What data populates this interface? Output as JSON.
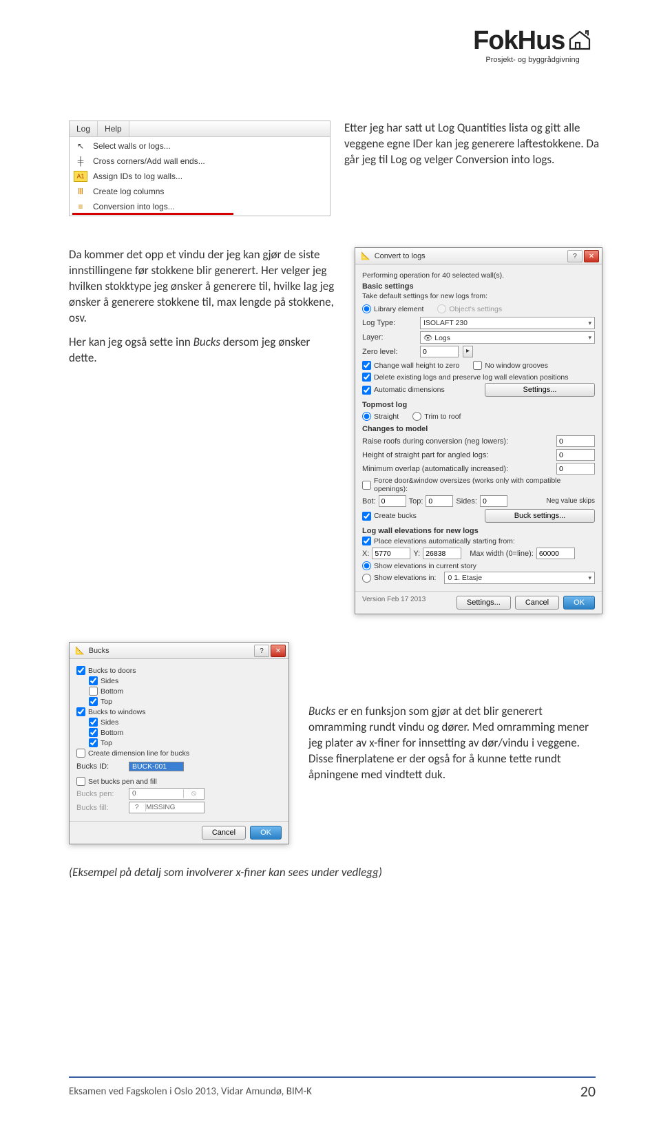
{
  "logo": {
    "main": "FokHus",
    "sub": "Prosjekt- og byggrådgivning",
    "house_icon": "house-outline-icon"
  },
  "menu": {
    "tabs": [
      "Log",
      "Help"
    ],
    "items": [
      {
        "icon": "cursor-icon",
        "label": "Select walls or logs..."
      },
      {
        "icon": "cross-icon",
        "label": "Cross corners/Add wall ends..."
      },
      {
        "icon": "a1-icon",
        "label": "Assign IDs to log walls..."
      },
      {
        "icon": "columns-icon",
        "label": "Create log columns"
      },
      {
        "icon": "logs-icon",
        "label": "Conversion into logs..."
      }
    ]
  },
  "para1": "Etter jeg har satt ut Log Quantities lista og gitt alle veggene egne IDer kan jeg generere laftestokkene. Da går jeg til Log og velger Conversion into logs.",
  "para2a": "Da kommer det opp et vindu der jeg kan gjør de siste innstillingene før stokkene blir generert. Her velger jeg hvilken stokktype jeg ønsker å generere til, hvilke lag jeg ønsker å generere stokkene til, max lengde på stokkene, osv.",
  "para2b": "Her kan jeg også sette inn Bucks dersom jeg ønsker dette.",
  "convert": {
    "title": "Convert to logs",
    "operation": "Performing operation for 40 selected wall(s).",
    "basic": "Basic settings",
    "take_from": "Take default settings for new logs from:",
    "radio_lib": "Library element",
    "radio_obj": "Object's settings",
    "log_type_label": "Log Type:",
    "log_type": "ISOLAFT 230",
    "layer_label": "Layer:",
    "layer": "Logs",
    "zero_label": "Zero level:",
    "zero": "0",
    "cb_change": "Change wall height to zero",
    "cb_nogroove": "No window grooves",
    "cb_delete": "Delete existing logs and preserve log wall elevation positions",
    "cb_auto": "Automatic dimensions",
    "settings_btn": "Settings...",
    "topmost": "Topmost log",
    "radio_straight": "Straight",
    "radio_trim": "Trim to roof",
    "changes": "Changes to model",
    "raise": "Raise roofs during conversion (neg lowers):",
    "height_straight": "Height of straight part for angled logs:",
    "min_overlap": "Minimum overlap (automatically increased):",
    "val0": "0",
    "cb_force": "Force door&window oversizes (works only with compatible openings):",
    "bot_label": "Bot:",
    "top_label": "Top:",
    "sides_label": "Sides:",
    "neg_label": "Neg value skips",
    "cb_bucks": "Create bucks",
    "buck_settings": "Buck settings...",
    "elev_title": "Log wall elevations for new logs",
    "cb_place": "Place elevations automatically starting from:",
    "x_label": "X:",
    "x": "5770",
    "y_label": "Y:",
    "y": "26838",
    "maxw_label": "Max width (0=line):",
    "maxw": "60000",
    "radio_current": "Show elevations in current story",
    "radio_showin": "Show elevations in:",
    "story": "0 1. Etasje",
    "version": "Version Feb 17 2013",
    "settings": "Settings...",
    "cancel": "Cancel",
    "ok": "OK"
  },
  "bucks": {
    "title": "Bucks",
    "cb_doors": "Bucks to doors",
    "cb_sides": "Sides",
    "cb_bottom": "Bottom",
    "cb_top": "Top",
    "cb_windows": "Bucks to windows",
    "cb_dim": "Create dimension line for bucks",
    "id_label": "Bucks ID:",
    "id": "BUCK-001",
    "cb_pen": "Set bucks pen and fill",
    "pen_label": "Bucks pen:",
    "pen": "0",
    "fill_label": "Bucks fill:",
    "fill_idx": "?",
    "fill": "MISSING",
    "cancel": "Cancel",
    "ok": "OK"
  },
  "para3": "Bucks er en funksjon som gjør at det blir generert omramming rundt vindu og dører. Med omramming mener jeg plater av x-finer for innsetting av dør/vindu i veggene. Disse finerplatene er der også for å kunne tette rundt åpningene med vindtett duk.",
  "note": "(Eksempel på detalj som involverer x-finer kan sees under vedlegg)",
  "footer_text": "Eksamen ved Fagskolen i Oslo 2013, Vidar Amundø, BIM-K",
  "page_num": "20"
}
